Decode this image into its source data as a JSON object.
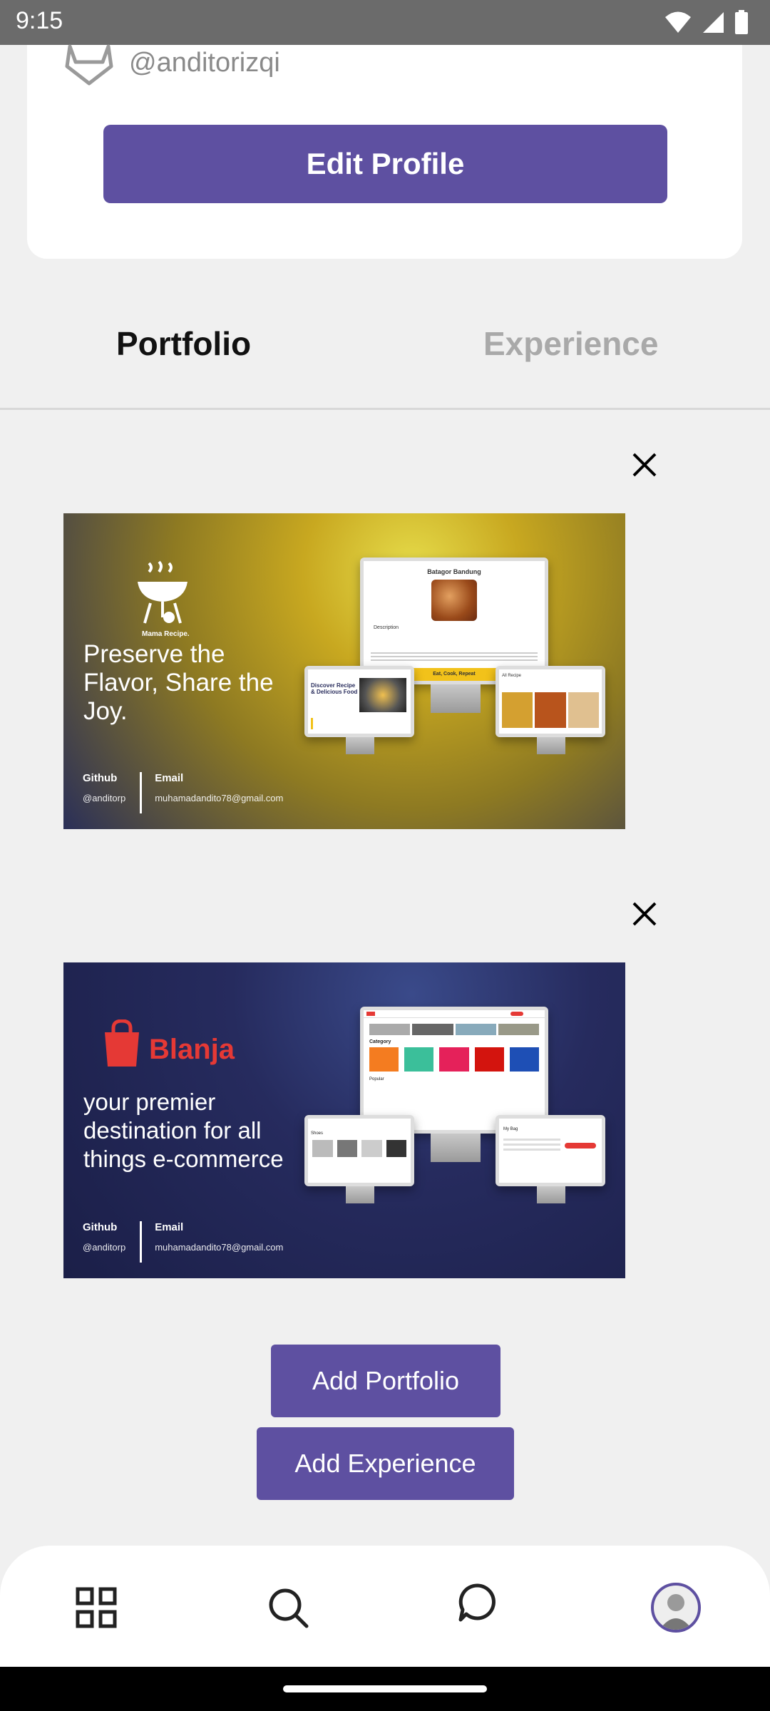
{
  "status_bar": {
    "time": "9:15"
  },
  "profile": {
    "gitlab_handle": "@anditorizqi",
    "edit_button": "Edit Profile"
  },
  "tabs": [
    {
      "label": "Portfolio",
      "active": true
    },
    {
      "label": "Experience",
      "active": false
    }
  ],
  "portfolio_items": [
    {
      "logo_text": "Mama Recipe.",
      "tagline": "Preserve the Flavor, Share the Joy.",
      "github_label": "Github",
      "github_value": "@anditorp",
      "email_label": "Email",
      "email_value": "muhamadandito78@gmail.com",
      "mock_title": "Batagor Bandung",
      "mock_description": "Description",
      "mock_footer": "Eat, Cook, Repeat",
      "mock_left_heading": "Discover Recipe & Delicious Food",
      "mock_right_heading": "All Recipe",
      "colors": {
        "from": "#e8c21a",
        "to": "#1c2650"
      }
    },
    {
      "logo_text": "Blanja",
      "tagline": "your premier destination for all things e-commerce",
      "github_label": "Github",
      "github_value": "@anditorp",
      "email_label": "Email",
      "email_value": "muhamadandito78@gmail.com",
      "mock_category": "Category",
      "mock_popular": "Popular",
      "mock_left_heading": "Shoes",
      "mock_right_heading": "My Bag",
      "colors": {
        "from": "#2b2f5e",
        "to": "#1a1e45"
      }
    }
  ],
  "actions": {
    "add_portfolio": "Add Portfolio",
    "add_experience": "Add Experience"
  },
  "bottom_nav": [
    {
      "name": "home",
      "icon": "grid-icon"
    },
    {
      "name": "search",
      "icon": "search-icon"
    },
    {
      "name": "chat",
      "icon": "chat-icon"
    },
    {
      "name": "profile",
      "icon": "avatar"
    }
  ],
  "theme": {
    "accent": "#5e50a1",
    "brand_red": "#e53935"
  }
}
